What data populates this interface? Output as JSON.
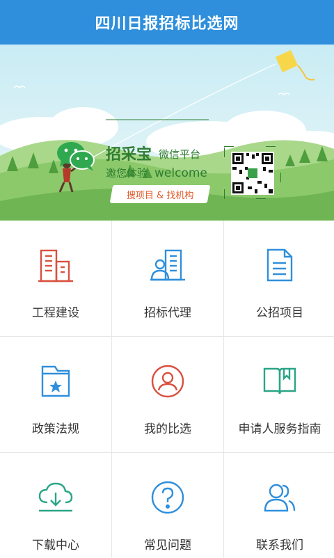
{
  "header": {
    "title": "四川日报招标比选网"
  },
  "banner": {
    "title": "招采宝",
    "subtitle": "微信平台",
    "slogan": "邀您体验",
    "slogan_en": "welcome",
    "link_text": "搜项目 & 找机构",
    "slides": 2,
    "active_slide": 1
  },
  "menu": [
    {
      "label": "工程建设",
      "icon": "buildings-icon",
      "color": "#d9503f"
    },
    {
      "label": "招标代理",
      "icon": "agent-building-icon",
      "color": "#2f8fdc"
    },
    {
      "label": "公招项目",
      "icon": "document-icon",
      "color": "#2f8fdc"
    },
    {
      "label": "政策法规",
      "icon": "policy-folder-icon",
      "color": "#2f8fdc"
    },
    {
      "label": "我的比选",
      "icon": "user-circle-icon",
      "color": "#d9503f"
    },
    {
      "label": "申请人服务指南",
      "icon": "open-book-icon",
      "color": "#2aa586"
    },
    {
      "label": "下载中心",
      "icon": "cloud-download-icon",
      "color": "#2aa586"
    },
    {
      "label": "常见问题",
      "icon": "question-icon",
      "color": "#2f8fdc"
    },
    {
      "label": "联系我们",
      "icon": "contacts-icon",
      "color": "#2f8fdc"
    }
  ]
}
